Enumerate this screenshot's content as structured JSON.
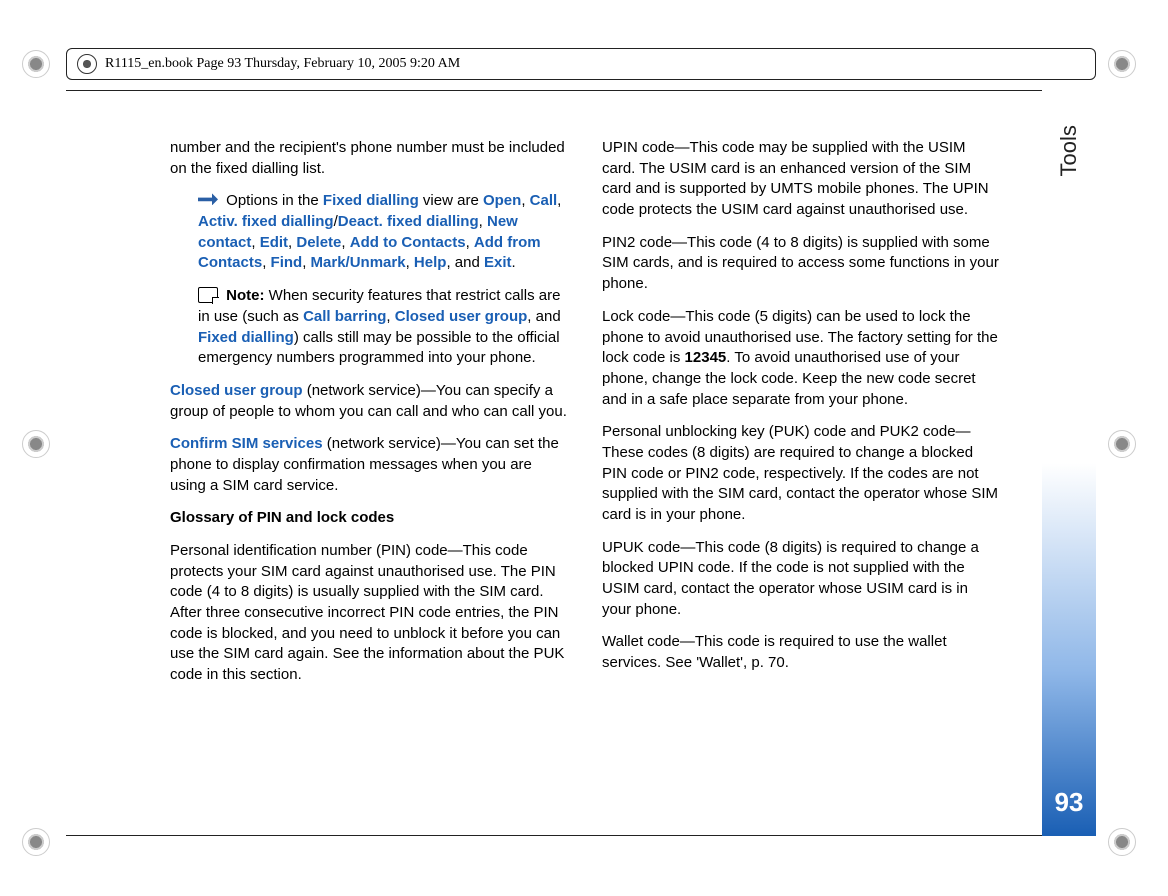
{
  "header": {
    "text": "R1115_en.book  Page 93  Thursday, February 10, 2005  9:20 AM"
  },
  "side": {
    "section": "Tools",
    "page_number": "93"
  },
  "body": {
    "p1": "number and the recipient's phone number must be included on the fixed dialling list.",
    "options_prefix": "Options in the ",
    "fixed_dialling": "Fixed dialling",
    "options_mid": " view are ",
    "opt_open": "Open",
    "c1": ", ",
    "opt_call": "Call",
    "c2": ", ",
    "opt_activ": "Activ. fixed dialling",
    "slash1": "/",
    "opt_deact": "Deact. fixed dialling",
    "c3": ", ",
    "opt_newc": "New contact",
    "c4": ", ",
    "opt_edit": "Edit",
    "c5": ", ",
    "opt_delete": "Delete",
    "c6": ", ",
    "opt_addtc": "Add to Contacts",
    "c7": ", ",
    "opt_addfc": "Add from Contacts",
    "c8": ", ",
    "opt_find": "Find",
    "c9": ", ",
    "opt_mark": "Mark/Unmark",
    "c10": ", ",
    "opt_help": "Help",
    "and1": ", and ",
    "opt_exit": "Exit",
    "dot1": ".",
    "note_label": "Note:",
    "note_pre": " When security features that restrict calls are in use (such as ",
    "cb": "Call barring",
    "nc1": ", ",
    "cug": "Closed user group",
    "nand": ", and ",
    "fd2": "Fixed dialling",
    "note_post": ") calls still may be possible to the official emergency numbers programmed into your phone.",
    "cug2": "Closed user group",
    "cug_rest": " (network service)—You can specify a group of people to whom you can call and who can call you.",
    "csim": "Confirm SIM services",
    "csim_rest": " (network service)—You can set the phone to display confirmation messages when you are using a SIM card service.",
    "glossary": "Glossary of PIN and lock codes",
    "pin_para": "Personal identification number (PIN) code—This code protects your SIM card against unauthorised use. The PIN code (4 to 8 digits) is usually supplied with the SIM card. After three consecutive incorrect PIN code entries, the PIN code is blocked, and you need to unblock it before you can use the SIM card again. See the information about the PUK code in this section.",
    "upin_para": "UPIN code—This code may be supplied with the USIM card. The USIM card is an enhanced version of the SIM card and is supported by UMTS mobile phones. The UPIN code protects the USIM card against unauthorised use.",
    "pin2_para": "PIN2 code—This code (4 to 8 digits) is supplied with some SIM cards, and is required to access some functions in your phone.",
    "lock_pre": "Lock code—This code (5 digits) can be used to lock the phone to avoid unauthorised use. The factory setting for the lock code is ",
    "lock_num": "12345",
    "lock_post": ". To avoid unauthorised use of your phone, change the lock code. Keep the new code secret and in a safe place separate from your phone.",
    "puk_para": "Personal unblocking key (PUK) code and PUK2 code—These codes (8 digits) are required to change a blocked PIN code or PIN2 code, respectively. If the codes are not supplied with the SIM card, contact the operator whose SIM card is in your phone.",
    "upuk_para": "UPUK code—This code (8 digits) is required to change a blocked UPIN code. If the code is not supplied with the USIM card, contact the operator whose USIM card is in your phone.",
    "wallet_para": "Wallet code—This code is required to use the wallet services. See 'Wallet', p. 70."
  }
}
